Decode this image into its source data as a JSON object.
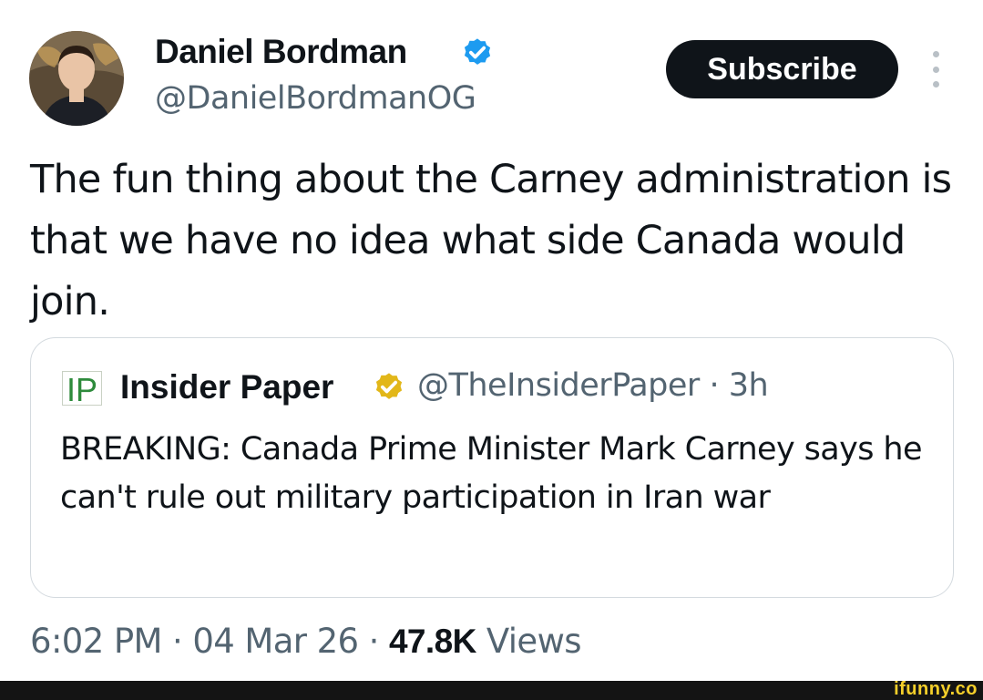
{
  "author": {
    "name": "Daniel Bordman",
    "handle": "@DanielBordmanOG",
    "verified": "blue-checkmark-icon"
  },
  "actions": {
    "subscribe_label": "Subscribe",
    "more": "more-options-icon"
  },
  "tweet": {
    "text": "The fun thing about the Carney administration is that we have no idea what side Canada would join."
  },
  "quote": {
    "logo_text": "IP",
    "name": "Insider Paper",
    "verified": "gold-checkmark-icon",
    "handle_time": "@TheInsiderPaper · 3h",
    "text": "BREAKING: Canada Prime Minister Mark Carney says he can't rule out military participation in Iran war"
  },
  "footer": {
    "datetime": "6:02 PM · 04 Mar 26 · ",
    "views_count": "47.8K",
    "views_label": " Views"
  },
  "watermark": "ifunny.co",
  "colors": {
    "text": "#0f1419",
    "secondary": "#536471",
    "verified_blue": "#1d9bf0",
    "verified_gold": "#e2b719",
    "watermark": "#f4cf2a"
  }
}
